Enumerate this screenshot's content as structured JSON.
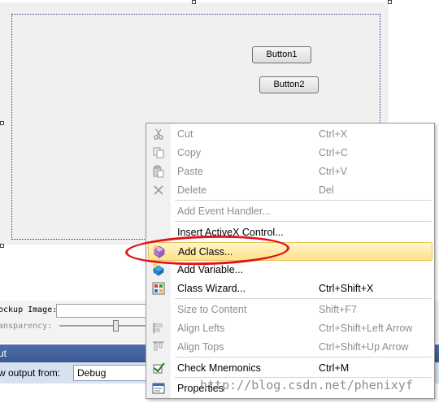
{
  "dialog": {
    "buttons": [
      {
        "label": "Button1"
      },
      {
        "label": "Button2"
      }
    ]
  },
  "properties": {
    "mockup_image_label": "ockup Image:",
    "transparency_label": "ansparency:"
  },
  "output": {
    "header": "ut",
    "show_from_label": "w output from:",
    "source_value": "Debug"
  },
  "context_menu": {
    "items": [
      {
        "label": "Cut",
        "shortcut": "Ctrl+X",
        "icon": "scissors-icon",
        "enabled": false
      },
      {
        "label": "Copy",
        "shortcut": "Ctrl+C",
        "icon": "copy-icon",
        "enabled": false
      },
      {
        "label": "Paste",
        "shortcut": "Ctrl+V",
        "icon": "paste-icon",
        "enabled": false
      },
      {
        "label": "Delete",
        "shortcut": "Del",
        "icon": "delete-x-icon",
        "enabled": false
      },
      {
        "label": "Add Event Handler...",
        "shortcut": "",
        "icon": "",
        "enabled": false
      },
      {
        "label": "Insert ActiveX Control...",
        "shortcut": "",
        "icon": "",
        "enabled": true
      },
      {
        "label": "Add Class...",
        "shortcut": "",
        "icon": "add-class-icon",
        "enabled": true,
        "highlighted": true
      },
      {
        "label": "Add Variable...",
        "shortcut": "",
        "icon": "add-variable-icon",
        "enabled": true
      },
      {
        "label": "Class Wizard...",
        "shortcut": "Ctrl+Shift+X",
        "icon": "class-wizard-icon",
        "enabled": true
      },
      {
        "label": "Size to Content",
        "shortcut": "Shift+F7",
        "icon": "",
        "enabled": false
      },
      {
        "label": "Align Lefts",
        "shortcut": "Ctrl+Shift+Left Arrow",
        "icon": "align-left-icon",
        "enabled": false
      },
      {
        "label": "Align Tops",
        "shortcut": "Ctrl+Shift+Up Arrow",
        "icon": "align-top-icon",
        "enabled": false
      },
      {
        "label": "Check Mnemonics",
        "shortcut": "Ctrl+M",
        "icon": "check-mnemonics-icon",
        "enabled": true
      },
      {
        "label": "Properties",
        "shortcut": "",
        "icon": "properties-icon",
        "enabled": true
      }
    ]
  },
  "annotation": {
    "ellipse_color": "#e0131c"
  },
  "watermark": "http://blog.csdn.net/phenixyf"
}
